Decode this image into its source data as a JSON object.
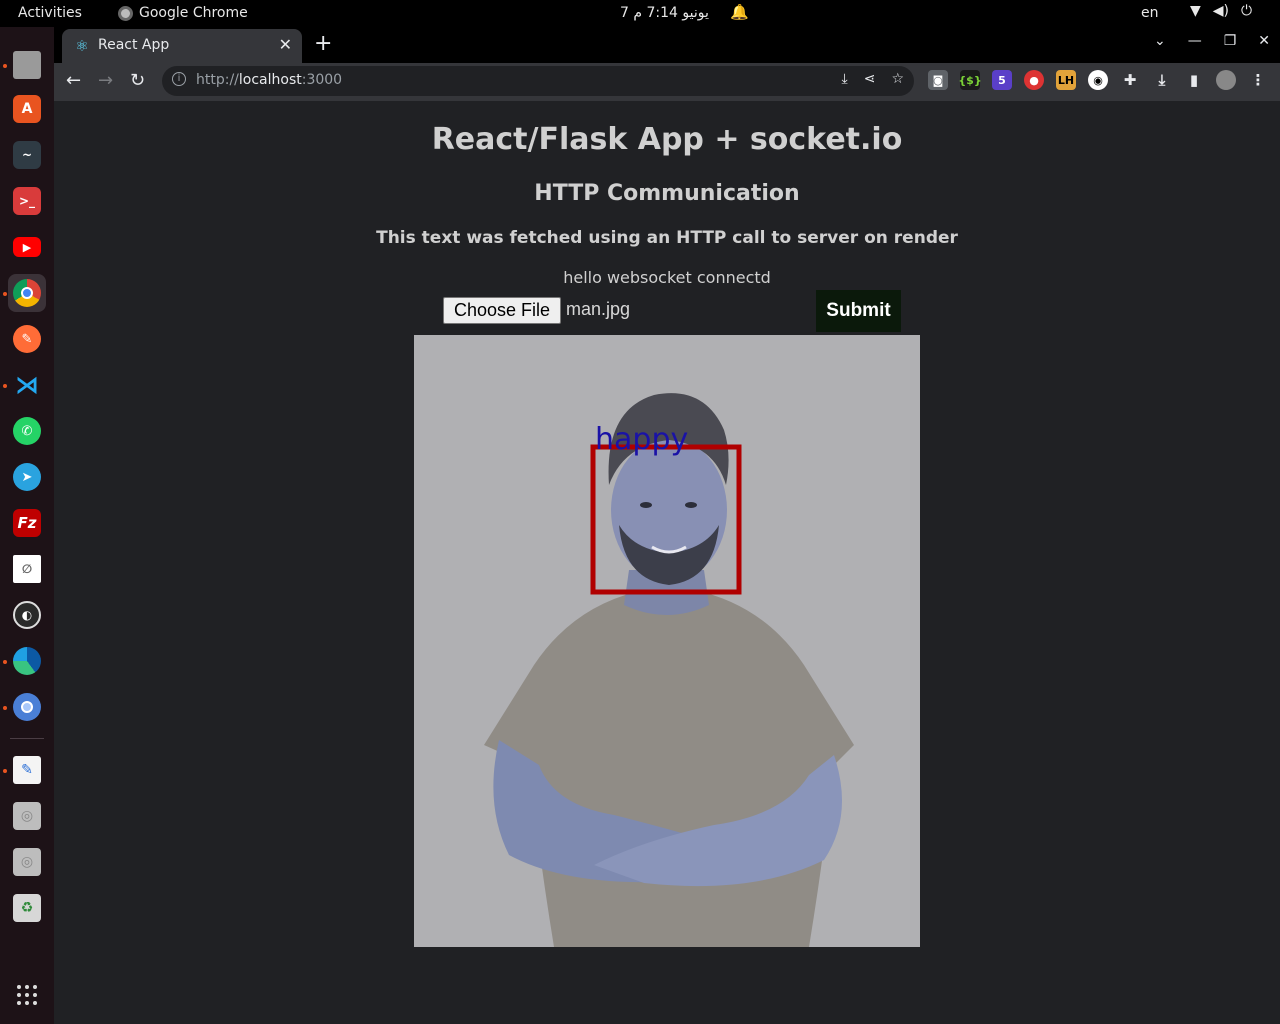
{
  "system_bar": {
    "activities": "Activities",
    "app_name": "Google Chrome",
    "clock": "7 يونيو  7:14 م",
    "language": "en"
  },
  "dock": {
    "items": [
      "files-icon",
      "app-center-icon",
      "system-monitor-icon",
      "terminal-icon",
      "youtube-icon",
      "chrome-icon",
      "postman-icon",
      "vscode-icon",
      "whatsapp-icon",
      "telegram-icon",
      "filezilla-icon",
      "libreoffice-icon",
      "obs-icon",
      "edge-icon",
      "chromium-icon",
      "text-editor-icon",
      "disk-icon",
      "disk-icon-2",
      "trash-icon"
    ]
  },
  "browser": {
    "tab_title": "React App",
    "url_scheme": "http://",
    "url_host": "localhost",
    "url_port": ":3000"
  },
  "page": {
    "title": "React/Flask App + socket.io",
    "subtitle": "HTTP Communication",
    "fetched_text": "This text was fetched using an HTTP call to server on render",
    "ws_message": "hello websocket connectd",
    "choose_file_label": "Choose File",
    "file_name": "man.jpg",
    "submit_label": "Submit",
    "detection_label": "happy"
  },
  "colors": {
    "page_bg": "#202124",
    "box": "#b00000",
    "label": "#1a12a6",
    "submit_bg": "#0b190b"
  }
}
